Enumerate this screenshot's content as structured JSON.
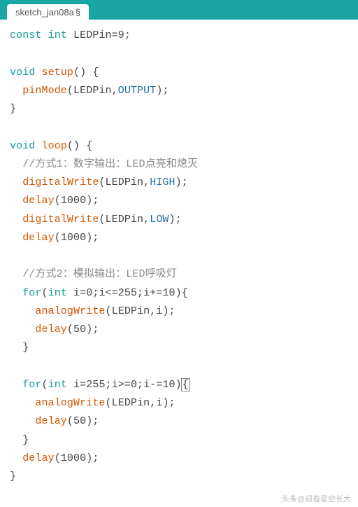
{
  "tab": {
    "name": "sketch_jan08a",
    "marker": "§"
  },
  "colors": {
    "tabbar": "#1aa5a5",
    "keyword": "#159C9C",
    "func": "#D35400",
    "const": "#1E6FA8",
    "comment": "#888"
  },
  "code": {
    "l1": {
      "kw1": "const",
      "kw2": "int",
      "rest": " LEDPin=9;"
    },
    "l3": {
      "kw": "void",
      "fn": "setup",
      "rest": "() {"
    },
    "l4": {
      "fn": "pinMode",
      "open": "(LEDPin,",
      "con": "OUTPUT",
      "close": ");"
    },
    "l5": {
      "txt": "}"
    },
    "l7": {
      "kw": "void",
      "fn": "loop",
      "rest": "() {"
    },
    "l8": {
      "cm": "//方式1：数字输出：LED点亮和熄灭"
    },
    "l9": {
      "fn": "digitalWrite",
      "open": "(LEDPin,",
      "con": "HIGH",
      "close": ");"
    },
    "l10": {
      "fn": "delay",
      "rest": "(1000);"
    },
    "l11": {
      "fn": "digitalWrite",
      "open": "(LEDPin,",
      "con": "LOW",
      "close": ");"
    },
    "l12": {
      "fn": "delay",
      "rest": "(1000);"
    },
    "l14": {
      "cm": "//方式2：模拟输出：LED呼吸灯"
    },
    "l15": {
      "kw": "for",
      "open": "(",
      "ty": "int",
      "rest": " i=0;i<=255;i+=10){"
    },
    "l16": {
      "fn": "analogWrite",
      "rest": "(LEDPin,i);"
    },
    "l17": {
      "fn": "delay",
      "rest": "(50);"
    },
    "l18": {
      "txt": "}"
    },
    "l20": {
      "kw": "for",
      "open": "(",
      "ty": "int",
      "rest": " i=255;i>=0;i-=10)",
      "brace": "{"
    },
    "l21": {
      "fn": "analogWrite",
      "rest": "(LEDPin,i);"
    },
    "l22": {
      "fn": "delay",
      "rest": "(50);"
    },
    "l23": {
      "txt": "}"
    },
    "l24": {
      "fn": "delay",
      "rest": "(1000);"
    },
    "l25": {
      "txt": "}"
    }
  },
  "watermark": "头条@迎着星空长大"
}
